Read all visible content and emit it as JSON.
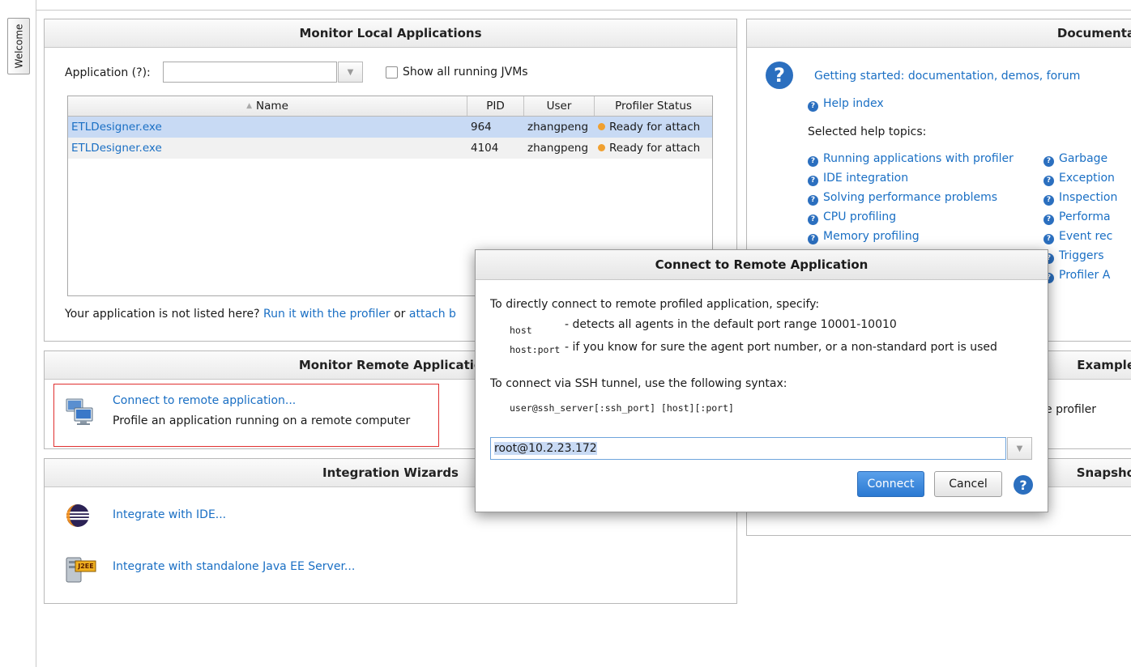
{
  "sidebar": {
    "welcome_tab": "Welcome"
  },
  "local": {
    "title": "Monitor Local Applications",
    "app_label": "Application (?):",
    "app_value": "",
    "show_all_label": "Show all running JVMs",
    "columns": [
      "Name",
      "PID",
      "User",
      "Profiler Status"
    ],
    "rows": [
      {
        "name": "ETLDesigner.exe",
        "pid": "964",
        "user": "zhangpeng",
        "status": "Ready for attach"
      },
      {
        "name": "ETLDesigner.exe",
        "pid": "4104",
        "user": "zhangpeng",
        "status": "Ready for attach"
      }
    ],
    "footer_text": "Your application is not listed here?",
    "footer_link1": "Run it with the profiler",
    "footer_or": "or",
    "footer_link2": "attach b"
  },
  "remote": {
    "title": "Monitor Remote Applicatio",
    "connect_link": "Connect to remote application...",
    "connect_desc": "Profile an application running on a remote computer"
  },
  "wizards": {
    "title": "Integration Wizards",
    "ide_link": "Integrate with IDE...",
    "javaee_link": "Integrate with standalone Java EE Server...",
    "j2ee_badge": "J2EE"
  },
  "docs": {
    "title": "Documenta",
    "getting_started": "Getting started: documentation, demos, forum",
    "help_index": "Help index",
    "selected_topics": "Selected help topics:",
    "topics_left": [
      "Running applications with profiler",
      "IDE integration",
      "Solving performance problems",
      "CPU profiling",
      "Memory profiling"
    ],
    "topics_right": [
      "Garbage",
      "Exception",
      "Inspection",
      "Performa",
      "Event rec",
      "Triggers",
      "Profiler A"
    ]
  },
  "examples": {
    "title": "Example",
    "text": "e profiler"
  },
  "snapshots": {
    "title": "Snapsho"
  },
  "dialog": {
    "title": "Connect to Remote Application",
    "intro": "To directly connect to remote profiled application, specify:",
    "host_code": "host",
    "host_desc": "- detects all agents in the default port range 10001-10010",
    "hostport_code": "host:port",
    "hostport_desc": "- if you know for sure the agent port number, or a non-standard port is used",
    "ssh_intro": "To connect via SSH tunnel, use the following syntax:",
    "ssh_syntax": "user@ssh_server[:ssh_port] [host][:port]",
    "input_value": "root@10.2.23.172",
    "connect_label": "Connect",
    "cancel_label": "Cancel"
  }
}
